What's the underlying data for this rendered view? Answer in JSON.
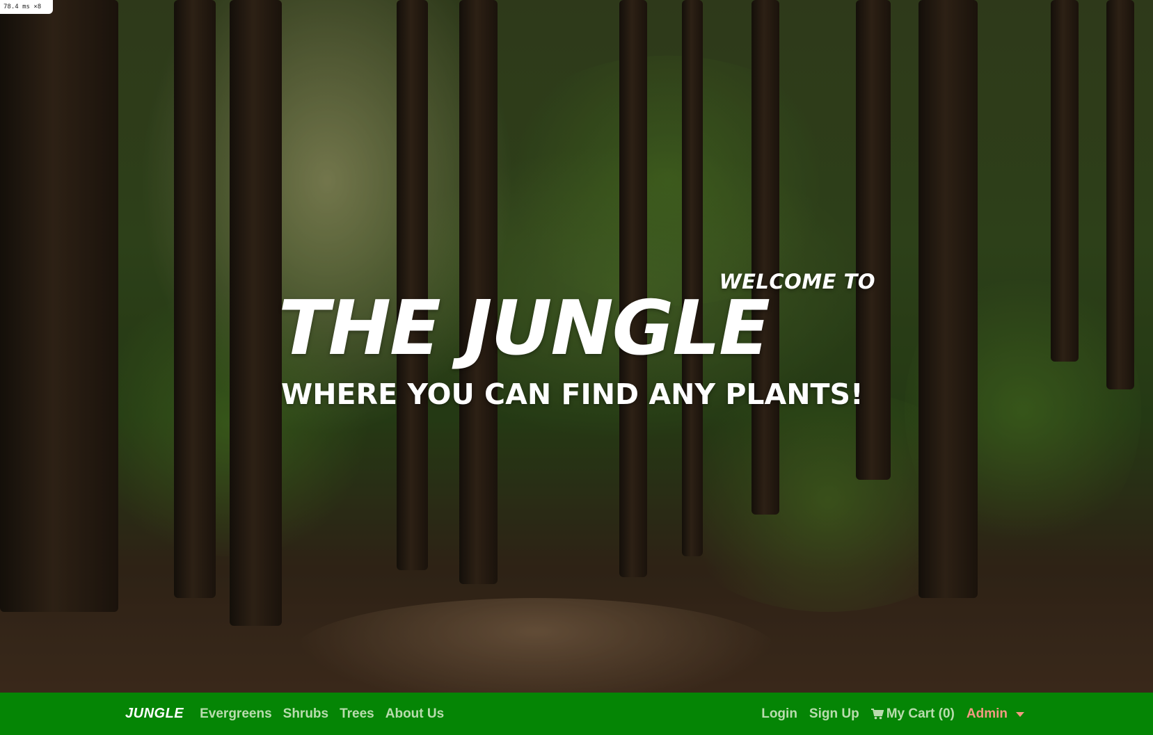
{
  "debug": {
    "badge_text": "78.4 ms ×8"
  },
  "hero": {
    "welcome": "WELCOME TO",
    "title": "THE JUNGLE",
    "subtitle": "WHERE YOU CAN FIND ANY PLANTS!"
  },
  "navbar": {
    "brand": "JUNGLE",
    "left_links": [
      "Evergreens",
      "Shrubs",
      "Trees",
      "About Us"
    ],
    "login": "Login",
    "signup": "Sign Up",
    "cart_label": "My Cart (0)",
    "cart_icon": "shopping-cart-icon",
    "admin": "Admin",
    "colors": {
      "background": "#058505",
      "link": "#b9dcae",
      "brand": "#ffffff",
      "admin": "#f39a82"
    }
  }
}
